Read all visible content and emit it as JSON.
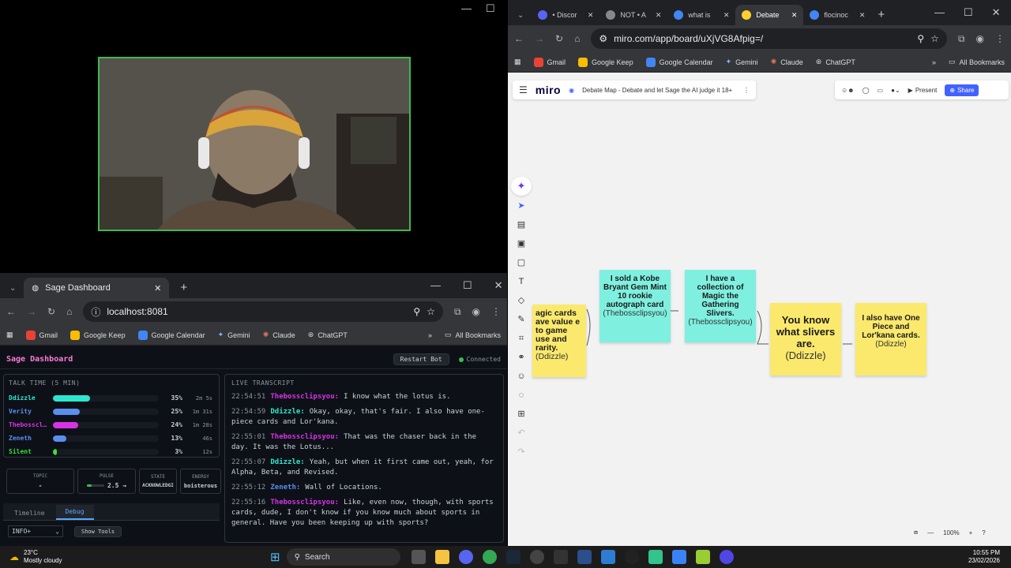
{
  "video": {
    "controls": [
      "—",
      "☐",
      "✕"
    ]
  },
  "sage_browser": {
    "tab_title": "Sage Dashboard",
    "url": "localhost:8081",
    "bookmarks": [
      "Gmail",
      "Google Keep",
      "Google Calendar",
      "Gemini",
      "Claude",
      "ChatGPT"
    ],
    "all_bookmarks": "All Bookmarks",
    "app_title": "Sage Dashboard",
    "restart": "Restart Bot",
    "status": "Connected",
    "talk_title": "TALK TIME",
    "talk_window": "(5 MIN)",
    "speakers": [
      {
        "name": "Ddizzle",
        "pct": "35%",
        "time": "2m 5s",
        "frac": 0.35,
        "color": "#2ee6d0"
      },
      {
        "name": "Verity",
        "pct": "25%",
        "time": "1m 31s",
        "frac": 0.25,
        "color": "#5b8def"
      },
      {
        "name": "Thebosscl…",
        "pct": "24%",
        "time": "1m 28s",
        "frac": 0.24,
        "color": "#d633e6"
      },
      {
        "name": "Zeneth",
        "pct": "13%",
        "time": "46s",
        "frac": 0.13,
        "color": "#5b8def"
      },
      {
        "name": "Silent",
        "pct": "3%",
        "time": "12s",
        "frac": 0.03,
        "color": "#3fdc3f"
      }
    ],
    "stats": [
      {
        "label": "TOPIC",
        "value": "-"
      },
      {
        "label": "PULSE",
        "value": "2.5 →"
      },
      {
        "label": "STATE",
        "value": "ACKNOWLEDGI"
      },
      {
        "label": "ENERGY",
        "value": "boisterous"
      }
    ],
    "tabs": [
      "Timeline",
      "Debug"
    ],
    "level": "INFO+",
    "show_tools": "Show Tools",
    "transcript_title": "LIVE TRANSCRIPT",
    "transcript": [
      {
        "time": "22:54:51",
        "who": "Thebossclipsyou:",
        "color": "#d633e6",
        "text": "I know what the lotus is."
      },
      {
        "time": "22:54:59",
        "who": "Ddizzle:",
        "color": "#2ee6d0",
        "text": "Okay, okay, that's fair. I also have one-piece cards and Lor'kana."
      },
      {
        "time": "22:55:01",
        "who": "Thebossclipsyou:",
        "color": "#d633e6",
        "text": "That was the chaser back in the day. It was the Lotus..."
      },
      {
        "time": "22:55:07",
        "who": "Ddizzle:",
        "color": "#2ee6d0",
        "text": "Yeah, but when it first came out, yeah, for Alpha, Beta, and Revised."
      },
      {
        "time": "22:55:12",
        "who": "Zeneth:",
        "color": "#5b8def",
        "text": "Wall of Locations."
      },
      {
        "time": "22:55:16",
        "who": "Thebossclipsyou:",
        "color": "#d633e6",
        "text": "Like, even now, though, with sports cards, dude, I don't know if you know much about sports in general. Have you been keeping up with sports?"
      }
    ]
  },
  "right_browser": {
    "tabs": [
      {
        "label": "• Discor",
        "color": "#5865f2",
        "active": false
      },
      {
        "label": "NOT • A",
        "color": "#888888",
        "active": false
      },
      {
        "label": "what is",
        "color": "#4285f4",
        "active": false
      },
      {
        "label": "Debate",
        "color": "#ffd02f",
        "active": true
      },
      {
        "label": "flocinoc",
        "color": "#4285f4",
        "active": false
      }
    ],
    "url": "miro.com/app/board/uXjVG8Afpig=/",
    "bookmarks": [
      "Gmail",
      "Google Keep",
      "Google Calendar",
      "Gemini",
      "Claude",
      "ChatGPT"
    ],
    "all_bookmarks": "All Bookmarks"
  },
  "miro": {
    "logo": "miro",
    "board_title": "Debate Map - Debate and let Sage the AI judge it 18+",
    "present": "Present",
    "share": "Share",
    "zoom": "100%",
    "notes": [
      {
        "text": "agic cards ave value e to game use and rarity.",
        "who": "(Ddizzle)",
        "color": "#fbe96d"
      },
      {
        "text": "I sold a Kobe Bryant Gem Mint 10 rookie autograph card",
        "who": "(Thebossclipsyou)",
        "color": "#7ff0e0"
      },
      {
        "text": "I have a collection of Magic the Gathering Slivers.",
        "who": "(Thebossclipsyou)",
        "color": "#7ff0e0"
      },
      {
        "text": "You know what slivers are.",
        "who": "(Ddizzle)",
        "color": "#fbe96d"
      },
      {
        "text": "I also have One Piece and Lor'kana cards.",
        "who": "(Ddizzle)",
        "color": "#fbe96d"
      }
    ]
  },
  "taskbar": {
    "temp": "23°C",
    "weather": "Mostly cloudy",
    "search": "Search",
    "time": "10:55 PM",
    "date": "23/02/2026"
  }
}
